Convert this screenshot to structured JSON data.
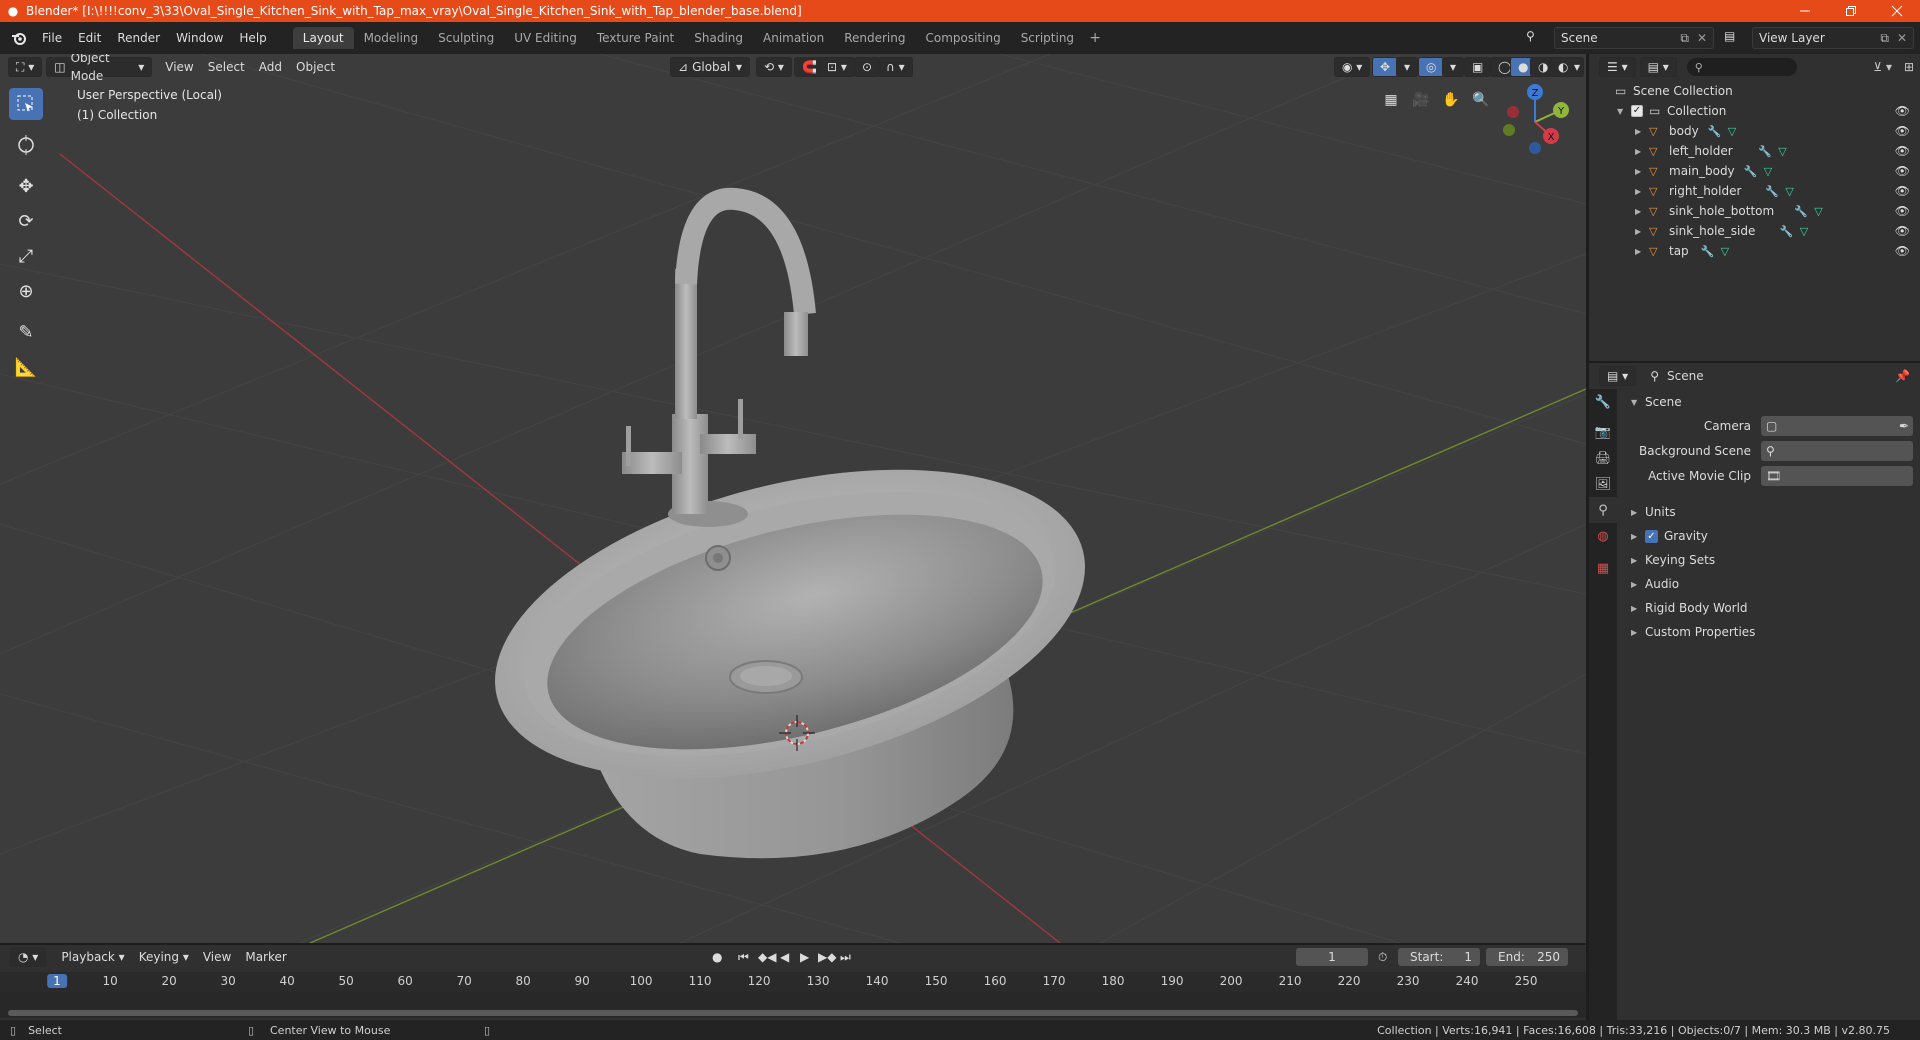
{
  "window": {
    "title": "Blender* [I:\\!!!!conv_3\\33\\Oval_Single_Kitchen_Sink_with_Tap_max_vray\\Oval_Single_Kitchen_Sink_with_Tap_blender_base.blend]",
    "controls": [
      "minimize",
      "maximize",
      "close"
    ]
  },
  "topbar": {
    "menus": [
      "File",
      "Edit",
      "Render",
      "Window",
      "Help"
    ],
    "workspaces": [
      "Layout",
      "Modeling",
      "Sculpting",
      "UV Editing",
      "Texture Paint",
      "Shading",
      "Animation",
      "Rendering",
      "Compositing",
      "Scripting"
    ],
    "active_workspace": "Layout",
    "scene_name": "Scene",
    "view_layer": "View Layer"
  },
  "viewport": {
    "mode": "Object Mode",
    "menus": [
      "View",
      "Select",
      "Add",
      "Object"
    ],
    "orientation": "Global",
    "info_line1": "User Perspective (Local)",
    "info_line2": "(1) Collection",
    "gizmo_axes": [
      "X",
      "Y",
      "Z"
    ]
  },
  "outliner": {
    "root": "Scene Collection",
    "collection": "Collection",
    "objects": [
      "body",
      "left_holder",
      "main_body",
      "right_holder",
      "sink_hole_bottom",
      "sink_hole_side",
      "tap"
    ]
  },
  "properties": {
    "context": "Scene",
    "panel_title": "Scene",
    "fields": [
      {
        "label": "Camera",
        "value": ""
      },
      {
        "label": "Background Scene",
        "value": ""
      },
      {
        "label": "Active Movie Clip",
        "value": ""
      }
    ],
    "sections": [
      "Units",
      "Gravity",
      "Keying Sets",
      "Audio",
      "Rigid Body World",
      "Custom Properties"
    ],
    "gravity_enabled": true
  },
  "timeline": {
    "menus": [
      "Playback",
      "Keying",
      "View",
      "Marker"
    ],
    "current_frame": "1",
    "start_label": "Start:",
    "start": "1",
    "end_label": "End:",
    "end": "250",
    "ticks": [
      "1",
      "10",
      "20",
      "30",
      "40",
      "50",
      "60",
      "70",
      "80",
      "90",
      "100",
      "110",
      "120",
      "130",
      "140",
      "150",
      "160",
      "170",
      "180",
      "190",
      "200",
      "210",
      "220",
      "230",
      "240",
      "250"
    ]
  },
  "statusbar": {
    "left_hint": "Select",
    "mid_hint": "Center View to Mouse",
    "stats": "Collection | Verts:16,941 | Faces:16,608 | Tris:33,216 | Objects:0/7 | Mem: 30.3 MB | v2.80.75"
  },
  "colors": {
    "title_bar": "#e64a19",
    "accent": "#4772b3",
    "x_axis": "#d33b4a",
    "y_axis": "#8fb539",
    "z_axis": "#3b7bd6",
    "mesh_icon": "#e59545",
    "modifier_icon": "#5aa9e6",
    "data_icon": "#3dd4a0"
  }
}
